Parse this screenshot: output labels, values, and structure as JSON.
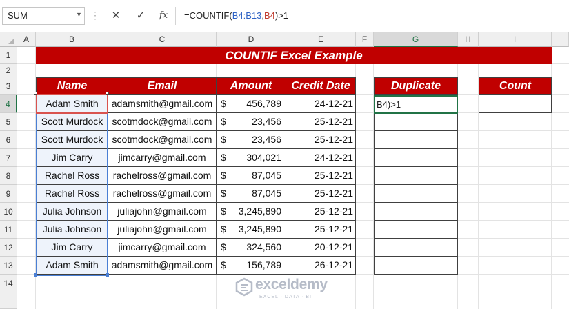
{
  "formula_bar": {
    "name_box": "SUM",
    "cancel_icon": "✕",
    "enter_icon": "✓",
    "fx_label": "fx",
    "formula_prefix": "=COUNTIF(",
    "formula_ref1": "B4:B13",
    "formula_comma": ",",
    "formula_ref2": "B4",
    "formula_suffix": ")>1"
  },
  "column_headers": [
    "A",
    "B",
    "C",
    "D",
    "E",
    "F",
    "G",
    "H",
    "I"
  ],
  "row_headers": [
    "1",
    "2",
    "3",
    "4",
    "5",
    "6",
    "7",
    "8",
    "9",
    "10",
    "11",
    "12",
    "13",
    "14"
  ],
  "title": "COUNTIF Excel Example",
  "table": {
    "headers": [
      "Name",
      "Email",
      "Amount",
      "Credit Date"
    ],
    "currency": "$",
    "rows": [
      {
        "name": "Adam Smith",
        "email": "adamsmith@gmail.com",
        "amount": "456,789",
        "date": "24-12-21"
      },
      {
        "name": "Scott Murdock",
        "email": "scotmdock@gmail.com",
        "amount": "23,456",
        "date": "25-12-21"
      },
      {
        "name": "Scott Murdock",
        "email": "scotmdock@gmail.com",
        "amount": "23,456",
        "date": "25-12-21"
      },
      {
        "name": "Jim Carry",
        "email": "jimcarry@gmail.com",
        "amount": "304,021",
        "date": "24-12-21"
      },
      {
        "name": "Rachel Ross",
        "email": "rachelross@gmail.com",
        "amount": "87,045",
        "date": "25-12-21"
      },
      {
        "name": "Rachel Ross",
        "email": "rachelross@gmail.com",
        "amount": "87,045",
        "date": "25-12-21"
      },
      {
        "name": "Julia Johnson",
        "email": "juliajohn@gmail.com",
        "amount": "3,245,890",
        "date": "25-12-21"
      },
      {
        "name": "Julia Johnson",
        "email": "juliajohn@gmail.com",
        "amount": "3,245,890",
        "date": "25-12-21"
      },
      {
        "name": "Jim Carry",
        "email": "jimcarry@gmail.com",
        "amount": "324,560",
        "date": "20-12-21"
      },
      {
        "name": "Adam Smith",
        "email": "adamsmith@gmail.com",
        "amount": "156,789",
        "date": "26-12-21"
      }
    ]
  },
  "duplicate": {
    "header": "Duplicate",
    "edit_text": "B4)>1"
  },
  "count": {
    "header": "Count"
  },
  "watermark": {
    "name": "exceldemy",
    "tagline": "EXCEL · DATA · BI"
  },
  "colors": {
    "header_red": "#c00000",
    "selection_green": "#217346",
    "range_blue": "#4a7fd4",
    "ref_red": "#c0392b"
  }
}
